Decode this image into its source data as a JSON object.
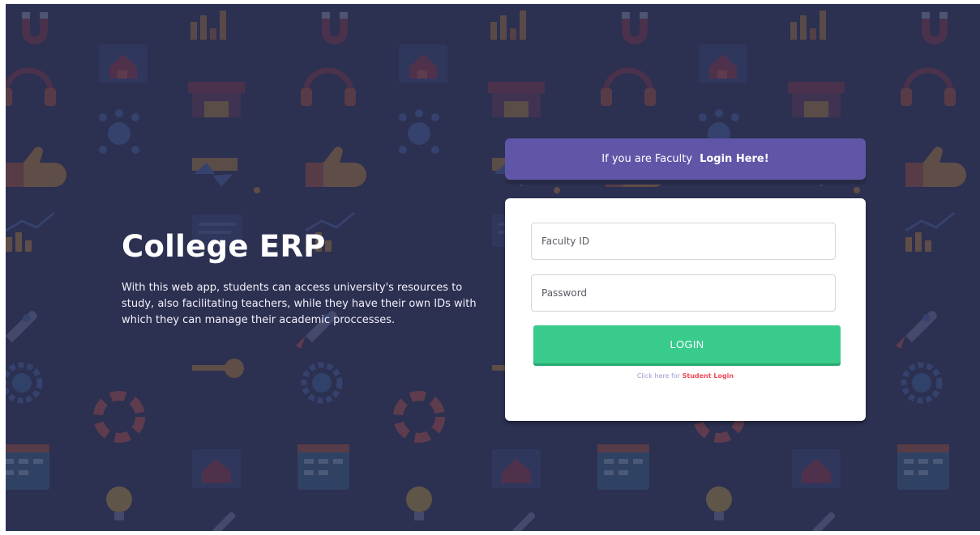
{
  "colors": {
    "background": "#323755",
    "faculty_banner": "#6056a8",
    "login_button": "#39cb8c",
    "student_link": "#f04a5a"
  },
  "hero": {
    "title": "College ERP",
    "description": "With this web app, students can access university's resources to study, also facilitating teachers, while they have their own IDs with which they can manage their academic proccesses."
  },
  "banner": {
    "text": "If you are Faculty",
    "link": "Login Here!"
  },
  "form": {
    "id_placeholder": "Faculty ID",
    "password_placeholder": "Password",
    "id_value": "",
    "password_value": "",
    "submit_label": "LOGIN",
    "switch_text": "Click here for",
    "switch_link": "Student Login"
  }
}
